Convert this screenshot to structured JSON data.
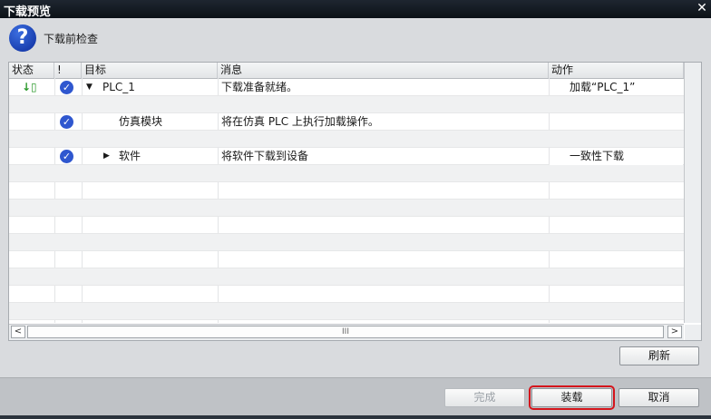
{
  "window": {
    "title": "下载预览",
    "close_glyph": "✕"
  },
  "header": {
    "text": "下载前检查",
    "icon": "question-icon"
  },
  "table": {
    "columns": [
      "状态",
      "!",
      "目标",
      "消息",
      "动作"
    ],
    "rows": [
      {
        "status_icon": "download-arrow-icon",
        "check": true,
        "expander": "▼",
        "target": "PLC_1",
        "message": "下载准备就绪。",
        "action": "加载“PLC_1”"
      },
      {
        "check": false,
        "target": "",
        "message": "",
        "action": ""
      },
      {
        "check": true,
        "target": "仿真模块",
        "message": "将在仿真 PLC 上执行加载操作。",
        "action": ""
      },
      {
        "check": false,
        "target": "",
        "message": "",
        "action": ""
      },
      {
        "check": true,
        "expander": "▶",
        "target": "软件",
        "message": "将软件下载到设备",
        "action": "一致性下载"
      }
    ]
  },
  "scrollbar": {
    "left": "<",
    "right": ">",
    "thumb": "III"
  },
  "buttons": {
    "refresh": "刷新",
    "finish": "完成",
    "load": "装载",
    "cancel": "取消"
  },
  "colors": {
    "highlight": "#d4151c",
    "check": "#2f57cf"
  }
}
